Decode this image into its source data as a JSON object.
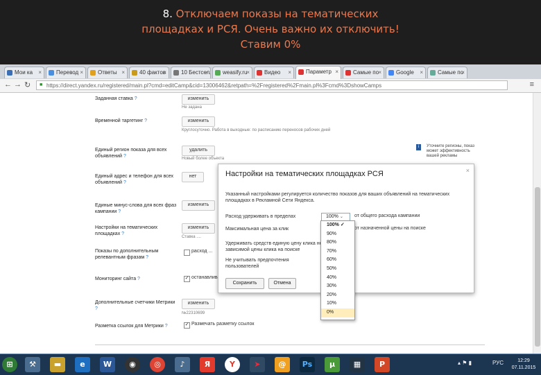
{
  "banner": {
    "number": "8.",
    "line1": "Отключаем показы на тематических",
    "line2": "площадках и РСЯ. Очень важно их отключить!",
    "line3": "Ставим 0%"
  },
  "tabs": [
    "Мои ка",
    "Перевод",
    "Ответы",
    "40 фактов",
    "10 Бестселл",
    "weasify.ru",
    "Видео",
    "Параметр",
    "Самые по",
    "Google",
    "Самые по"
  ],
  "address": {
    "url": "https://direct.yandex.ru/registered/main.pl?cmd=editCamp&cid=13006462&retpath=%2Fregistered%2Fmain.pl%3Fcmd%3DshowCamps"
  },
  "page": {
    "rows": [
      {
        "label": "Заданная ставка",
        "button": "изменить",
        "sub": "Не задана"
      },
      {
        "label": "Временной таргетинг",
        "button": "изменить",
        "sub": "Круглосуточно. Работа в выходные: по расписанию переносов рабочих дней"
      },
      {
        "label": "Единый регион показа для всех объявлений",
        "button": "удалить",
        "sub": "Новый более объекта"
      },
      {
        "label": "Единый адрес и телефон для всех объявлений",
        "button": "нет",
        "sub": ""
      },
      {
        "label": "Единые минус-слова для всех фраз кампании",
        "button": "изменить",
        "sub": ""
      },
      {
        "label": "Настройки на тематических площадках",
        "button": "изменить",
        "sub": "Ставка ...."
      },
      {
        "label": "Показы по дополнительным релевантным фразам",
        "button": "",
        "sub": "расход ..."
      },
      {
        "label": "Мониторинг сайта",
        "button": "",
        "sub": "останавливать ..."
      },
      {
        "label": "Дополнительные счетчики Метрики",
        "button": "изменить",
        "sub": "№22310699"
      },
      {
        "label": "Разметка ссылок для Метрики",
        "button": "",
        "sub": "Размечать разметку ссылок"
      }
    ],
    "side_hint": "Уточните регионы, показ может эффективность вашей рекламы"
  },
  "modal": {
    "title": "Настройки на тематических площадках РСЯ",
    "close": "×",
    "description": "Указанный настройками регулируется количество показов для ваших объявлений на тематических площадках в Рекламной Сети Яндекса.",
    "spend_label": "Расход удерживать в пределах",
    "spend_value": "100%",
    "spend_note": "от общего расхода кампании",
    "max_price_label": "Максимальная цена за клик",
    "max_price_note": "от назначенной цены на поиске",
    "hold_label": "Удерживать средств единую цену клика не зависимой цены клика на поиске",
    "no_consider_label": "Не учитывать предпочтения пользователей",
    "save": "Сохранить",
    "cancel": "Отмена"
  },
  "dropdown": {
    "options": [
      "100%",
      "90%",
      "80%",
      "70%",
      "60%",
      "50%",
      "40%",
      "30%",
      "20%",
      "10%",
      "0%"
    ],
    "selected": "100%",
    "highlighted": "0%"
  },
  "taskbar": {
    "lang": "РУС",
    "time": "12:29",
    "date": "07.11.2015"
  },
  "colors": {
    "banner_text": "#e97a50",
    "highlight": "#ffeebc",
    "taskbar": "#1c3550"
  }
}
